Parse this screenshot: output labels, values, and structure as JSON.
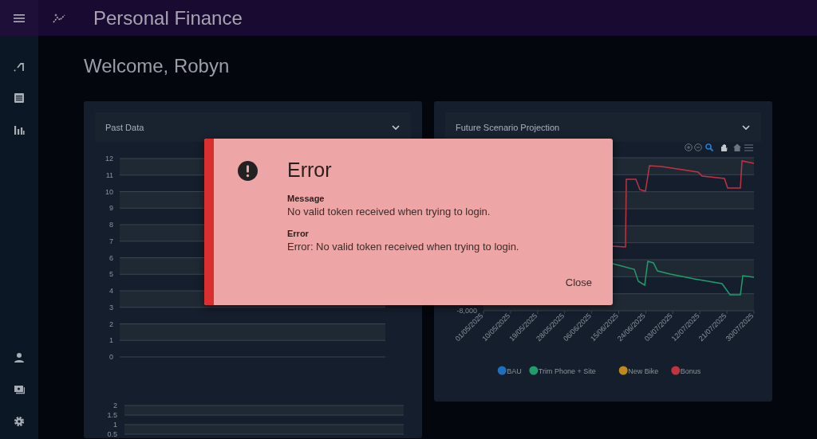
{
  "app": {
    "title": "Personal Finance"
  },
  "greeting": "Welcome, Robyn",
  "panels": [
    {
      "title": "Past Data",
      "charts": [
        {
          "y_ticks": [
            "12",
            "11",
            "10",
            "9",
            "8",
            "7",
            "6",
            "5",
            "4",
            "3",
            "2",
            "1",
            "0"
          ]
        },
        {
          "y_ticks": [
            "2",
            "1.5",
            "1",
            "0.5"
          ]
        }
      ]
    },
    {
      "title": "Future Scenario Projection",
      "y_tick_label": "-8,000",
      "x_labels": [
        "01/05/2025",
        "10/05/2025",
        "19/05/2025",
        "28/05/2025",
        "06/06/2025",
        "15/06/2025",
        "24/06/2025",
        "03/07/2025",
        "12/07/2025",
        "21/07/2025",
        "30/07/2025"
      ],
      "legend": [
        {
          "label": "BAU",
          "color": "#1f6fbf"
        },
        {
          "label": "Trim Phone + Site",
          "color": "#1f9e6a"
        },
        {
          "label": "New Bike",
          "color": "#c08a1a"
        },
        {
          "label": "Bonus",
          "color": "#c0343f"
        }
      ]
    }
  ],
  "dialog": {
    "title": "Error",
    "fields": [
      {
        "label": "Message",
        "value": "No valid token received when trying to login."
      },
      {
        "label": "Error",
        "value": "Error: No valid token received when trying to login."
      }
    ],
    "buttons": [
      "Close"
    ]
  }
}
